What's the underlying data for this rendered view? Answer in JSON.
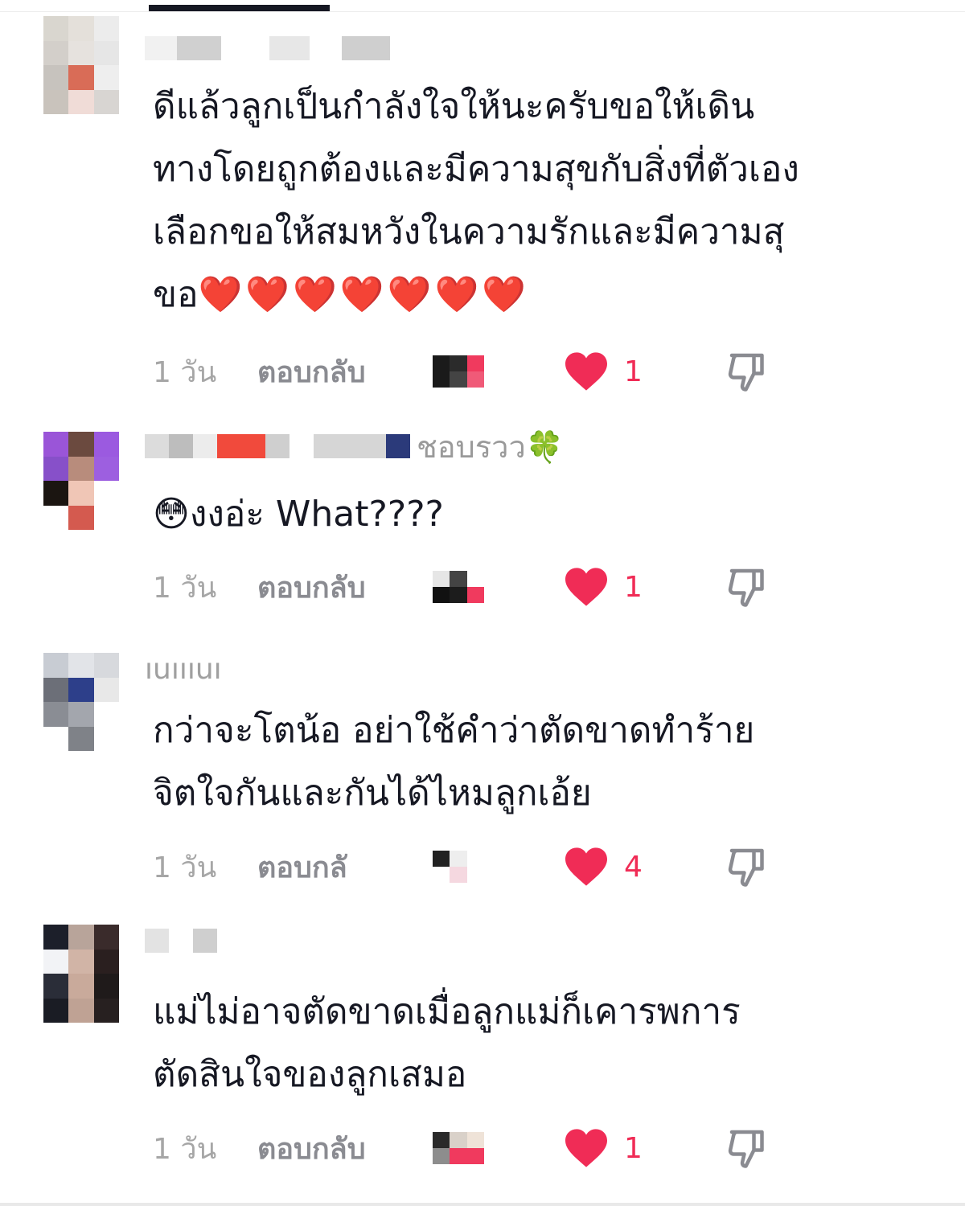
{
  "comments": [
    {
      "username_suffix": "",
      "text_lines": [
        "ดีแล้วลูกเป็นกำลังใจให้นะครับขอให้เดิน",
        "ทางโดยถูกต้องและมีความสุขกับสิ่งที่ตัวเอง",
        "เลือกขอให้สมหวังในความรักและมีความสุ",
        "ขอ"
      ],
      "emoji": "❤️❤️❤️❤️❤️❤️❤️",
      "time": "1 วัน",
      "reply_label": "ตอบกลับ",
      "likes": "1"
    },
    {
      "username_suffix": "ชอบรวว🍀",
      "text_lines": [
        "😳งงอ่ะ What????"
      ],
      "emoji": "",
      "time": "1 วัน",
      "reply_label": "ตอบกลับ",
      "likes": "1"
    },
    {
      "username_suffix": "ıuıııuı",
      "text_lines": [
        "กว่าจะโตน้อ อย่าใช้คำว่าตัดขาดทำร้าย",
        "จิตใจกันและกันได้ไหมลูกเอ้ย"
      ],
      "emoji": "",
      "time": "1 วัน",
      "reply_label": "ตอบกลั",
      "likes": "4"
    },
    {
      "username_suffix": "",
      "text_lines": [
        "แม่ไม่อาจตัดขาดเมื่อลูกแม่ก็เคารพการ",
        "ตัดสินใจของลูกเสมอ"
      ],
      "emoji": "",
      "time": "1 วัน",
      "reply_label": "ตอบกลับ",
      "likes": "1"
    }
  ],
  "colors": {
    "like_red": "#f02c56",
    "text": "#161823",
    "muted": "#a6a6a6"
  },
  "icons": {
    "like": "heart-icon",
    "dislike": "thumbs-down-icon"
  }
}
